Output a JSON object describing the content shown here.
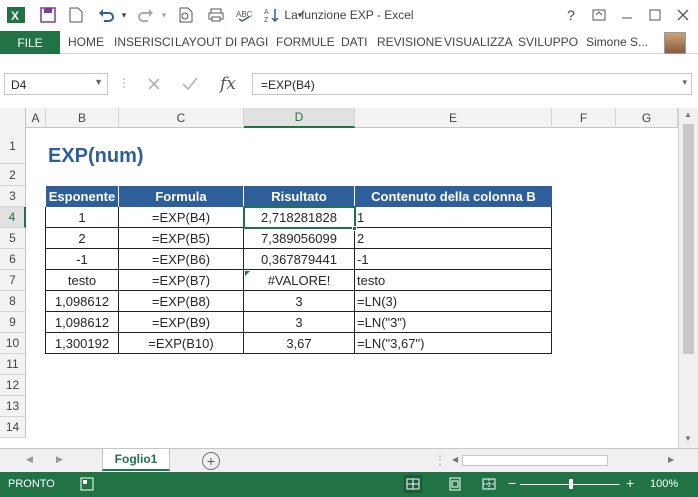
{
  "window": {
    "title": "La funzione EXP - Excel"
  },
  "ribbon": {
    "file": "FILE",
    "tabs": [
      "HOME",
      "INSERISCI",
      "LAYOUT DI PAGI",
      "FORMULE",
      "DATI",
      "REVISIONE",
      "VISUALIZZA",
      "SVILUPPO"
    ],
    "user": "Simone S..."
  },
  "formula_bar": {
    "name_box": "D4",
    "formula": "=EXP(B4)",
    "fx": "fx"
  },
  "columns": [
    "A",
    "B",
    "C",
    "D",
    "E",
    "F",
    "G"
  ],
  "rows": [
    "1",
    "2",
    "3",
    "4",
    "5",
    "6",
    "7",
    "8",
    "9",
    "10",
    "11",
    "12",
    "13",
    "14"
  ],
  "sheet": {
    "title": "EXP(num)",
    "headers": [
      "Esponente",
      "Formula",
      "Risultato",
      "Contenuto della colonna B"
    ],
    "rows": [
      [
        "1",
        "=EXP(B4)",
        "2,718281828",
        "1"
      ],
      [
        "2",
        "=EXP(B5)",
        "7,389056099",
        "2"
      ],
      [
        "-1",
        "=EXP(B6)",
        "0,367879441",
        "-1"
      ],
      [
        "testo",
        "=EXP(B7)",
        "#VALORE!",
        "testo"
      ],
      [
        "1,098612",
        "=EXP(B8)",
        "3",
        "=LN(3)"
      ],
      [
        "1,098612",
        "=EXP(B9)",
        "3",
        "=LN(\"3\")"
      ],
      [
        "1,300192",
        "=EXP(B10)",
        "3,67",
        "=LN(\"3,67\")"
      ]
    ]
  },
  "tabs": {
    "sheet_name": "Foglio1"
  },
  "status": {
    "text": "PRONTO",
    "zoom": "100%"
  },
  "colors": {
    "excel_green": "#217346",
    "header_blue": "#2e5f9b"
  }
}
